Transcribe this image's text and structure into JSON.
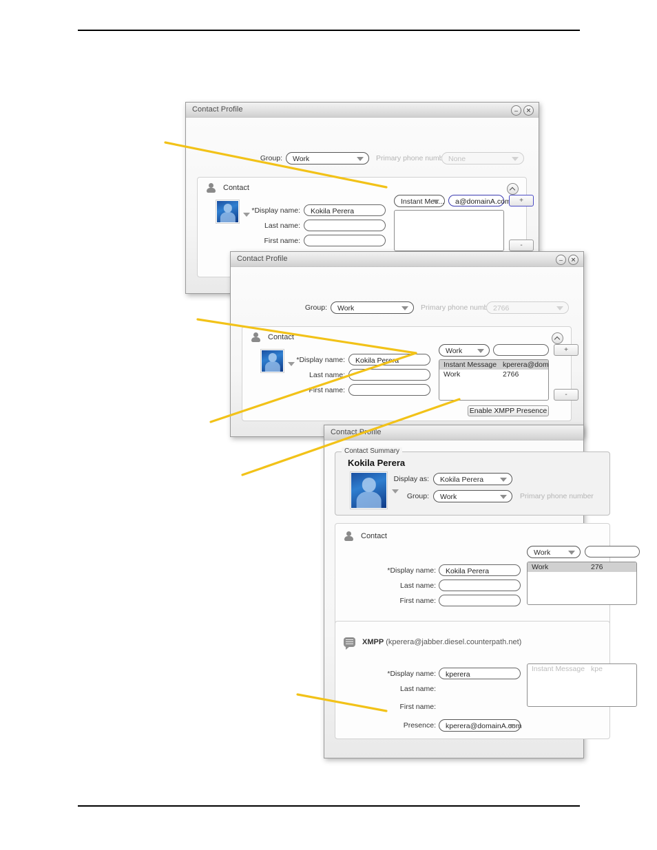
{
  "page": {
    "rule_color": "#000000",
    "leader_color": "#F2C218"
  },
  "windows": [
    {
      "id": "win1",
      "title": "Contact Profile",
      "minimize_icon": "minimize-icon",
      "close_icon": "close-icon",
      "group_label": "Group:",
      "group_value": "Work",
      "primary_phone_label": "Primary phone number:",
      "primary_phone_value": "None",
      "section_title": "Contact",
      "display_name_label": "*Display name:",
      "display_name_value": "Kokila Perera",
      "last_name_label": "Last name:",
      "last_name_value": "",
      "first_name_label": "First name:",
      "first_name_value": "",
      "method_value": "Instant Mes...",
      "address_value": "a@domainA.com",
      "add_button": "+",
      "remove_button": "-",
      "list_rows": []
    },
    {
      "id": "win2",
      "title": "Contact Profile",
      "minimize_icon": "minimize-icon",
      "close_icon": "close-icon",
      "group_label": "Group:",
      "group_value": "Work",
      "primary_phone_label": "Primary phone number:",
      "primary_phone_value": "2766",
      "section_title": "Contact",
      "display_name_label": "*Display name:",
      "display_name_value": "Kokila Perera",
      "last_name_label": "Last name:",
      "last_name_value": "",
      "first_name_label": "First name:",
      "first_name_value": "",
      "method_value": "Work",
      "address_value": "",
      "add_button": "+",
      "remove_button": "-",
      "enable_xmpp_button": "Enable XMPP Presence",
      "list_rows": [
        {
          "type": "Instant Message",
          "value": "kperera@domai...",
          "selected": true
        },
        {
          "type": "Work",
          "value": "2766",
          "selected": false
        }
      ]
    },
    {
      "id": "win3",
      "title": "Contact Profile",
      "summary_legend": "Contact Summary",
      "summary_name": "Kokila Perera",
      "display_as_label": "Display as:",
      "display_as_value": "Kokila Perera",
      "group_label": "Group:",
      "group_value": "Work",
      "primary_phone_label": "Primary phone number",
      "section_title": "Contact",
      "display_name_label": "*Display name:",
      "display_name_value": "Kokila Perera",
      "last_name_label": "Last name:",
      "last_name_value": "",
      "first_name_label": "First name:",
      "first_name_value": "",
      "method_value": "Work",
      "list_rows": [
        {
          "type": "Work",
          "value": "276",
          "selected": true
        }
      ],
      "xmpp_title": "XMPP",
      "xmpp_address": "(kperera@jabber.diesel.counterpath.net)",
      "xmpp_display_name_label": "*Display name:",
      "xmpp_display_name_value": "kperera",
      "xmpp_last_name_label": "Last name:",
      "xmpp_first_name_label": "First name:",
      "xmpp_presence_label": "Presence:",
      "xmpp_presence_value": "kperera@domainA.com",
      "xmpp_list_rows": [
        {
          "type": "Instant Message",
          "value": "kpe",
          "selected": false
        }
      ]
    }
  ]
}
